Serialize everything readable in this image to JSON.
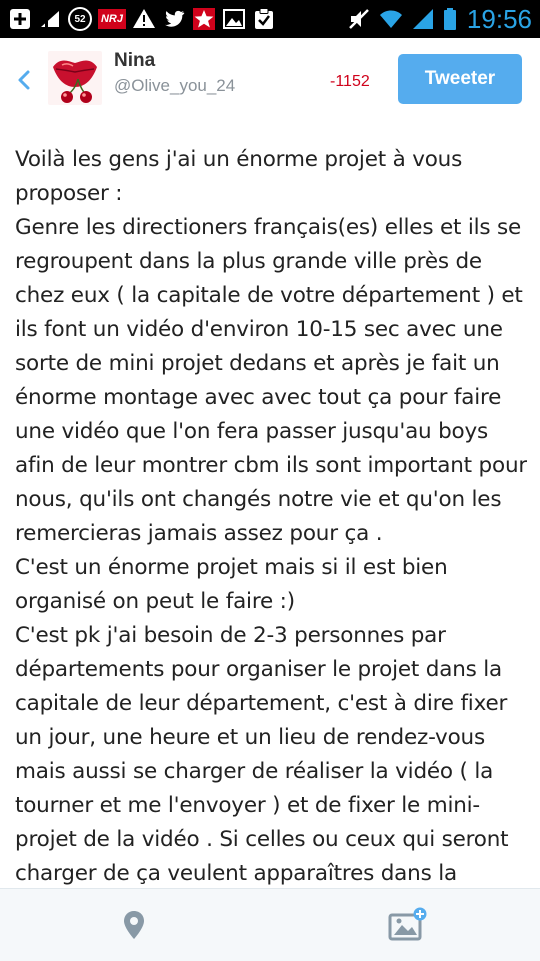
{
  "status_bar": {
    "left_icons": [
      "add-box-icon",
      "cellular-data-icon",
      "notification-count-icon",
      "nrj-app-icon",
      "warning-icon",
      "twitter-icon",
      "star-app-icon",
      "image-icon",
      "clipboard-check-icon"
    ],
    "notification_count": "52",
    "nrj_label": "NRJ",
    "right_icons": [
      "mute-icon",
      "wifi-icon",
      "signal-icon",
      "battery-icon"
    ],
    "time": "19:56",
    "time_color": "#2aa4e6"
  },
  "header": {
    "back_icon": "chevron-left-icon",
    "user_name": "Nina",
    "user_handle": "@Olive_you_24",
    "char_counter": "-1152",
    "tweet_button_label": "Tweeter",
    "accent_color": "#55acee",
    "counter_color": "#d0021b"
  },
  "compose": {
    "paragraphs": [
      "Voilà les gens j'ai un énorme projet à vous proposer :",
      "Genre les directioners français(es) elles et ils se regroupent dans la plus grande ville près de chez eux ( la capitale de votre département ) et ils font un vidéo d'environ 10-15 sec avec une sorte de mini projet dedans et après je fait un énorme montage avec avec tout ça pour faire une vidéo que l'on fera passer jusqu'au boys afin de leur montrer cbm ils sont important pour nous, qu'ils ont changés notre vie et qu'on les remercieras jamais assez pour ça .",
      "C'est un énorme projet mais si il est bien organisé on peut le faire :)",
      "C'est pk j'ai besoin de 2-3 personnes par départements pour organiser le projet dans la capitale de leur département, c'est à dire fixer un jour, une heure et un lieu de rendez-vous mais aussi se charger de réaliser la vidéo ( la tourner et me l'envoyer ) et de fixer le mini-projet de la vidéo . Si celles ou ceux qui seront charger de ça veulent apparaîtres dans la"
    ]
  },
  "toolbar": {
    "location_icon": "location-pin-icon",
    "add_photo_icon": "add-photo-icon"
  }
}
